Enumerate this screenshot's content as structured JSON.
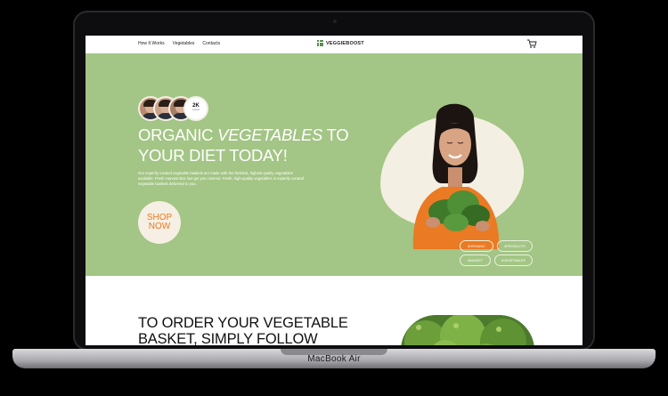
{
  "device": {
    "label": "MacBook Air"
  },
  "nav": {
    "links": [
      "How It Works",
      "Vegetables",
      "Contacts"
    ],
    "brand": "VEGGIEBOOST",
    "cart_icon": "cart-icon"
  },
  "hero": {
    "social_count": "2K",
    "social_sub": "reviews",
    "headline_part1": "ORGANIC ",
    "headline_italic": "VEGETABLES",
    "headline_part2": " TO YOUR DIET TODAY!",
    "description": "Our expertly curated vegetable baskets are made with the freshest, highest quality vegetables available. Fresh Harvest Box has got you covered. Fresh, high-quality vegetables in expertly curated vegetable baskets delivered to you.",
    "cta_line1": "SHOP",
    "cta_line2": "NOW",
    "tags": [
      "#ORGANIC",
      "#PRODUCTS",
      "#BASKET",
      "#VEGETABLES"
    ]
  },
  "lower": {
    "title": "TO ORDER YOUR VEGETABLE BASKET, SIMPLY FOLLOW"
  },
  "colors": {
    "hero_bg": "#a3c585",
    "cta_text": "#ea7a23",
    "cream": "#f6efe3"
  }
}
